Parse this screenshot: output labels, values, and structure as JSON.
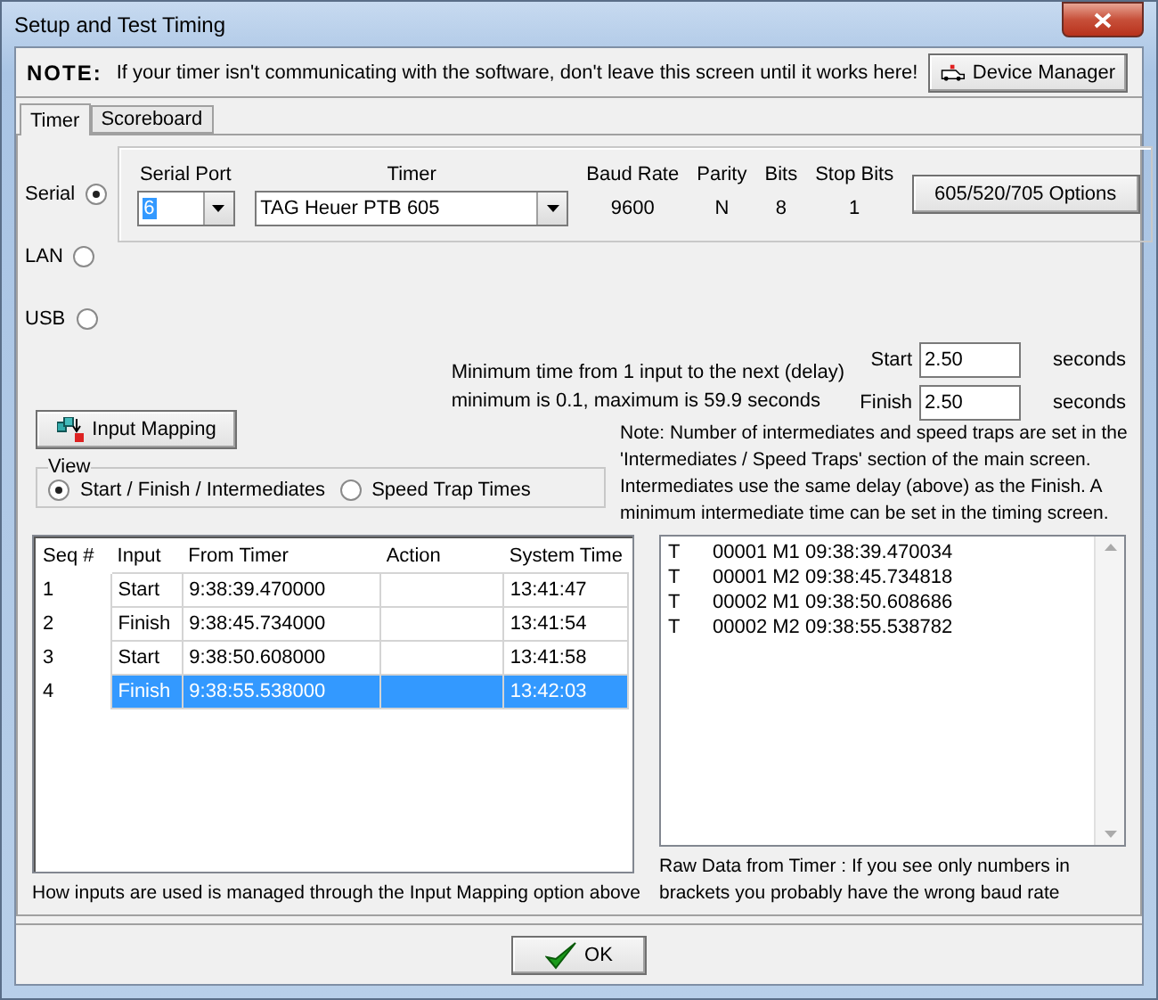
{
  "window": {
    "title": "Setup and Test Timing"
  },
  "note": {
    "label": "NOTE:",
    "text": "If your timer isn't communicating with the software, don't leave this screen until it works here!"
  },
  "device_manager_button": "Device Manager",
  "tabs": [
    {
      "label": "Timer",
      "selected": true
    },
    {
      "label": "Scoreboard",
      "selected": false
    }
  ],
  "connections": [
    {
      "label": "Serial",
      "selected": true
    },
    {
      "label": "LAN",
      "selected": false
    },
    {
      "label": "USB",
      "selected": false
    }
  ],
  "serial": {
    "port_label": "Serial Port",
    "port": "6",
    "timer_label": "Timer",
    "timer": "TAG Heuer PTB 605",
    "fields": [
      {
        "label": "Baud Rate",
        "value": "9600"
      },
      {
        "label": "Parity",
        "value": "N"
      },
      {
        "label": "Bits",
        "value": "8"
      },
      {
        "label": "Stop Bits",
        "value": "1"
      }
    ]
  },
  "options_button": "605/520/705 Options",
  "delay": {
    "lines": [
      "Minimum time from 1 input to the next (delay)",
      "minimum is 0.1, maximum is 59.9 seconds"
    ],
    "fields": [
      {
        "label": "Start",
        "value": "2.50",
        "unit": "seconds"
      },
      {
        "label": "Finish",
        "value": "2.50",
        "unit": "seconds"
      }
    ]
  },
  "input_mapping_button": "Input Mapping",
  "view": {
    "title": "View",
    "options": [
      {
        "label": "Start / Finish / Intermediates",
        "selected": true
      },
      {
        "label": "Speed Trap Times",
        "selected": false
      }
    ]
  },
  "intermediates_note": [
    "Note: Number of intermediates and speed traps are set in the",
    "'Intermediates / Speed Traps' section of the main screen.",
    "Intermediates use the same delay (above) as the Finish. A",
    "minimum intermediate time can be set in the timing screen."
  ],
  "table": {
    "columns": [
      "Seq #",
      "Input",
      "From Timer",
      "Action",
      "System Time"
    ],
    "rows": [
      {
        "cells": [
          "1",
          "Start",
          "9:38:39.470000",
          "",
          "13:41:47"
        ],
        "selected": false
      },
      {
        "cells": [
          "2",
          "Finish",
          "9:38:45.734000",
          "",
          "13:41:54"
        ],
        "selected": false
      },
      {
        "cells": [
          "3",
          "Start",
          "9:38:50.608000",
          "",
          "13:41:58"
        ],
        "selected": false
      },
      {
        "cells": [
          "4",
          "Finish",
          "9:38:55.538000",
          "",
          "13:42:03"
        ],
        "selected": true
      }
    ]
  },
  "raw_data": [
    {
      "type": "T",
      "data": "00001 M1 09:38:39.470034"
    },
    {
      "type": "T",
      "data": "00001 M2 09:38:45.734818"
    },
    {
      "type": "T",
      "data": "00002 M1 09:38:50.608686"
    },
    {
      "type": "T",
      "data": "00002 M2 09:38:55.538782"
    }
  ],
  "table_caption": "How inputs are used is managed through the Input Mapping option above",
  "raw_caption": [
    "Raw Data from Timer : If you see only numbers in",
    "brackets you probably have the wrong baud rate"
  ],
  "ok_button": "OK"
}
